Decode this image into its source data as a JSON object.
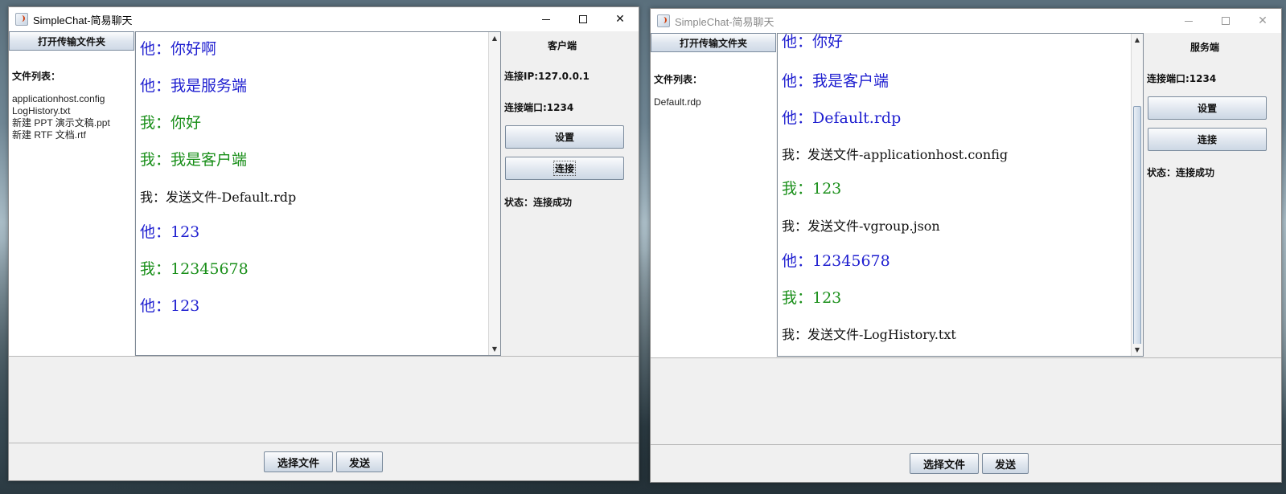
{
  "client": {
    "title": "SimpleChat-简易聊天",
    "open_folder_label": "打开传输文件夹",
    "file_list_label": "文件列表：",
    "files": [
      "applicationhost.config",
      "LogHistory.txt",
      "新建 PPT 演示文稿.ppt",
      "新建 RTF 文档.rtf"
    ],
    "messages": [
      {
        "kind": "other",
        "text": "他：你好啊"
      },
      {
        "kind": "other",
        "text": "他：我是服务端"
      },
      {
        "kind": "me",
        "text": "我：你好"
      },
      {
        "kind": "me",
        "text": "我：我是客户端"
      },
      {
        "kind": "file",
        "text": "我：发送文件-Default.rdp"
      },
      {
        "kind": "other",
        "text": "他：123"
      },
      {
        "kind": "me",
        "text": "我：12345678"
      },
      {
        "kind": "other",
        "text": "他：123"
      }
    ],
    "role_title": "客户端",
    "ip_text": "连接IP:127.0.0.1",
    "port_text": "连接端口:1234",
    "settings_label": "设置",
    "connect_label": "连接",
    "status_text": "状态：连接成功",
    "choose_file_label": "选择文件",
    "send_label": "发送"
  },
  "server": {
    "title": "SimpleChat-简易聊天",
    "open_folder_label": "打开传输文件夹",
    "file_list_label": "文件列表：",
    "files": [
      "Default.rdp"
    ],
    "messages": [
      {
        "kind": "other",
        "text": "他：你好"
      },
      {
        "kind": "other",
        "text": "他：我是客户端"
      },
      {
        "kind": "other",
        "text": "他：Default.rdp"
      },
      {
        "kind": "file",
        "text": "我：发送文件-applicationhost.config"
      },
      {
        "kind": "me",
        "text": "我：123"
      },
      {
        "kind": "file",
        "text": "我：发送文件-vgroup.json"
      },
      {
        "kind": "other",
        "text": "他：12345678"
      },
      {
        "kind": "me",
        "text": "我：123"
      },
      {
        "kind": "file",
        "text": "我：发送文件-LogHistory.txt"
      }
    ],
    "role_title": "服务端",
    "port_text": "连接端口:1234",
    "settings_label": "设置",
    "connect_label": "连接",
    "status_text": "状态：连接成功",
    "choose_file_label": "选择文件",
    "send_label": "发送"
  },
  "colors": {
    "other_message": "#1f1fd0",
    "my_message": "#1a8f1a",
    "file_message": "#111111"
  },
  "icons": {
    "app": "java-cup-icon",
    "minimize": "minimize-icon",
    "maximize": "maximize-icon",
    "close": "close-icon"
  }
}
